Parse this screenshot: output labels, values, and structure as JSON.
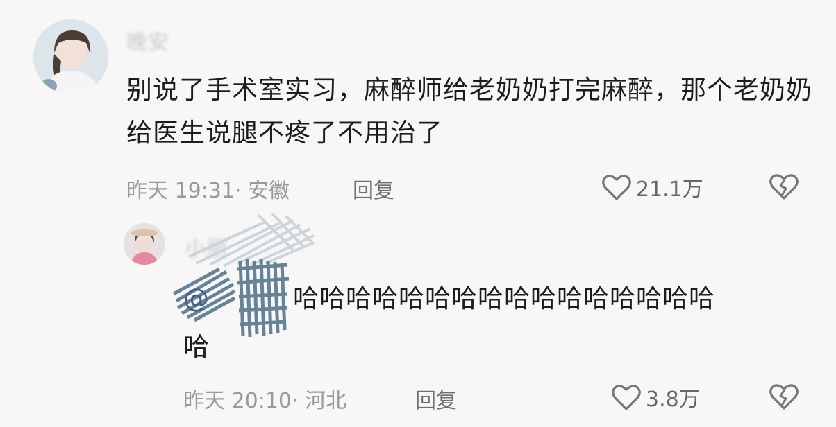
{
  "comments": [
    {
      "username": "晚安",
      "text": "别说了手术室实习，麻醉师给老奶奶打完麻醉，那个老奶奶给医生说腿不疼了不用治了",
      "time": "昨天 19:31",
      "location": "· 安徽",
      "reply_label": "回复",
      "likes": "21.1万"
    },
    {
      "username": "小丽",
      "mention": "@",
      "text_line1": "哈哈哈哈哈哈哈哈哈哈哈哈哈哈哈哈",
      "text_line2": "哈",
      "time": "昨天 20:10",
      "location": "· 河北",
      "reply_label": "回复",
      "likes": "3.8万"
    }
  ],
  "colors": {
    "background": "#f7f7f7",
    "text": "#1c1c1c",
    "meta": "#9a9a9a",
    "scribble": "#4f6f86"
  },
  "icons": [
    "heart-icon",
    "broken-heart-icon"
  ]
}
